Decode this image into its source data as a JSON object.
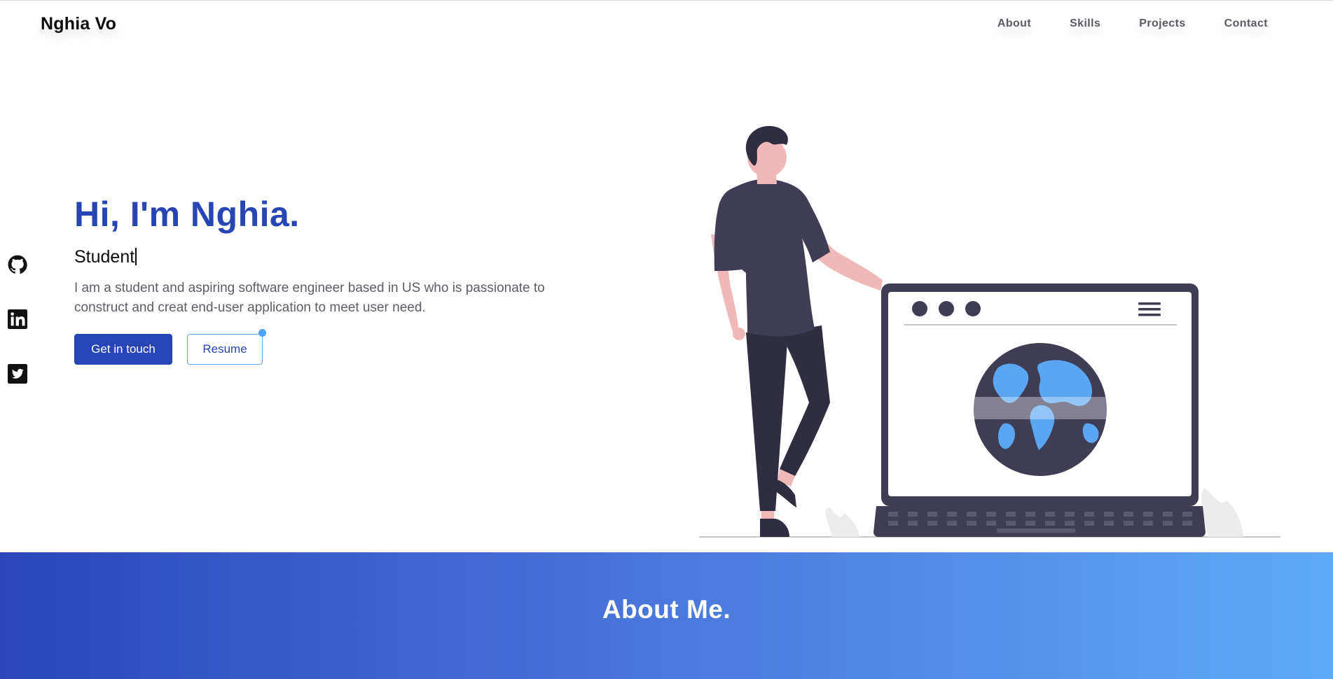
{
  "navbar": {
    "brand": "Nghia Vo",
    "links": [
      {
        "label": "About"
      },
      {
        "label": "Skills"
      },
      {
        "label": "Projects"
      },
      {
        "label": "Contact"
      }
    ]
  },
  "social": [
    {
      "icon": "github-icon"
    },
    {
      "icon": "linkedin-icon"
    },
    {
      "icon": "twitter-icon"
    }
  ],
  "hero": {
    "title": "Hi, I'm Nghia.",
    "subtitle": "Student",
    "description": "I am a student and aspiring software engineer based in US who is passionate to construct and creat end-user application to meet user need.",
    "primary_button": "Get in touch",
    "secondary_button": "Resume"
  },
  "about": {
    "title": "About Me."
  },
  "colors": {
    "accent": "#2745b5",
    "light_accent": "#5aa6f2",
    "gradient_start": "#2b45b8",
    "gradient_end": "#60aaf8",
    "text_muted": "#5d5d66"
  }
}
